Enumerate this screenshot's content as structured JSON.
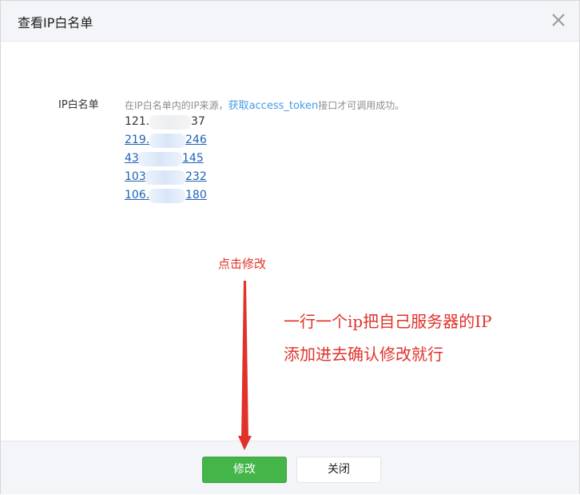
{
  "dialog": {
    "title": "查看IP白名单"
  },
  "whitelist": {
    "label": "IP白名单",
    "desc_prefix": "在IP白名单内的IP来源，",
    "desc_link": "获取access_token",
    "desc_suffix": "接口才可调用成功。",
    "ips": [
      {
        "prefix": "121.",
        "suffix": "37"
      },
      {
        "prefix": "219.",
        "suffix": "246"
      },
      {
        "prefix": "43",
        "suffix": "145"
      },
      {
        "prefix": "103",
        "suffix": "232"
      },
      {
        "prefix": "106.",
        "suffix": "180"
      }
    ]
  },
  "annotations": {
    "click_hint": "点击修改",
    "line1": "一行一个ip把自己服务器的IP",
    "line2": "添加进去确认修改就行",
    "color": "#e0322a"
  },
  "footer": {
    "modify_label": "修改",
    "close_label": "关闭"
  },
  "colors": {
    "primary_green": "#44b549",
    "link_blue": "#459ae9",
    "ip_link": "#1e62b6"
  }
}
